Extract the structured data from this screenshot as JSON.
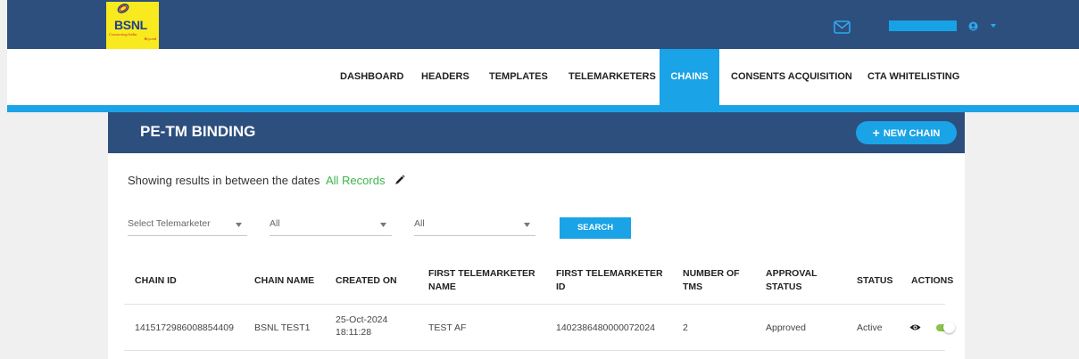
{
  "brand": {
    "logo_text": "BSNL",
    "tagline_line1": "Connecting India",
    "tagline_line2": "Beyond"
  },
  "header": {
    "icons": [
      "mail-icon",
      "user-circle-icon",
      "chevron-down-icon"
    ],
    "accent_color": "#1aa3e6",
    "bar_color": "#2d4f7e"
  },
  "nav": {
    "items": [
      {
        "label": "DASHBOARD"
      },
      {
        "label": "HEADERS"
      },
      {
        "label": "TEMPLATES"
      },
      {
        "label": "TELEMARKETERS"
      },
      {
        "label": "CHAINS"
      },
      {
        "label": "CONSENTS ACQUISITION"
      },
      {
        "label": "CTA WHITELISTING"
      }
    ],
    "active": "CHAINS"
  },
  "page": {
    "title": "PE-TM BINDING",
    "new_button_label": "NEW CHAIN",
    "results_text": "Showing results in between the dates",
    "results_range": "All Records"
  },
  "filters": {
    "telemarketer": {
      "value": "Select Telemarketer"
    },
    "filter2": {
      "value": "All"
    },
    "filter3": {
      "value": "All"
    },
    "search_label": "SEARCH"
  },
  "table": {
    "headers": {
      "chain_id": "CHAIN ID",
      "chain_name": "CHAIN NAME",
      "created_on": "CREATED ON",
      "first_tm_name_1": "FIRST TELEMARKETER",
      "first_tm_name_2": "NAME",
      "first_tm_id_1": "FIRST TELEMARKETER",
      "first_tm_id_2": "ID",
      "num_tms_1": "NUMBER OF",
      "num_tms_2": "TMS",
      "approval_1": "APPROVAL",
      "approval_2": "STATUS",
      "status": "STATUS",
      "actions": "ACTIONS"
    },
    "rows": [
      {
        "chain_id": "1415172986008854409",
        "chain_name": "BSNL TEST1",
        "created_date": "25-Oct-2024",
        "created_time": "18:11:28",
        "first_tm_name": "TEST AF",
        "first_tm_id": "1402386480000072024",
        "num_tms": "2",
        "approval_status": "Approved",
        "status": "Active",
        "enabled": true
      }
    ]
  }
}
